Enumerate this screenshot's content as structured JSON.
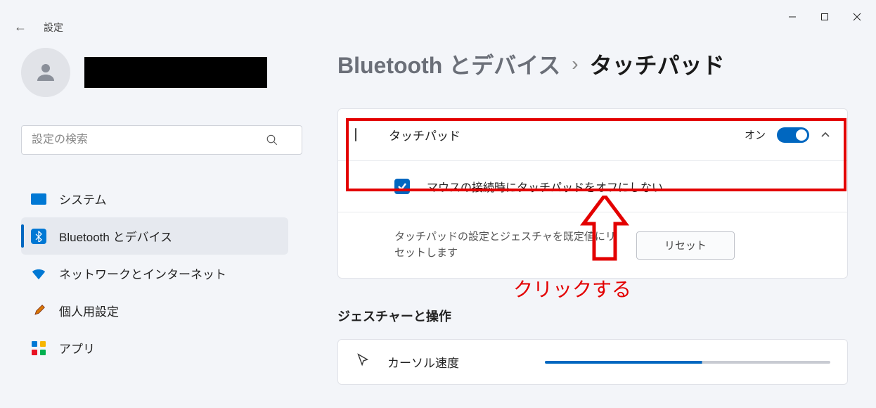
{
  "window": {
    "app_title": "設定"
  },
  "profile": {
    "username_redacted": true
  },
  "search": {
    "placeholder": "設定の検索"
  },
  "nav": {
    "system": "システム",
    "bluetooth": "Bluetooth とデバイス",
    "network": "ネットワークとインターネット",
    "personalization": "個人用設定",
    "apps": "アプリ"
  },
  "breadcrumb": {
    "parent": "Bluetooth とデバイス",
    "current": "タッチパッド"
  },
  "touchpad": {
    "label": "タッチパッド",
    "toggle_state": "オン",
    "mouse_option": "マウスの接続時にタッチパッドをオフにしない",
    "reset_text": "タッチパッドの設定とジェスチャを既定値にリセットします",
    "reset_button": "リセット"
  },
  "gestures": {
    "title": "ジェスチャーと操作",
    "cursor_speed": "カーソル速度"
  },
  "annotation": {
    "text": "クリックする"
  }
}
